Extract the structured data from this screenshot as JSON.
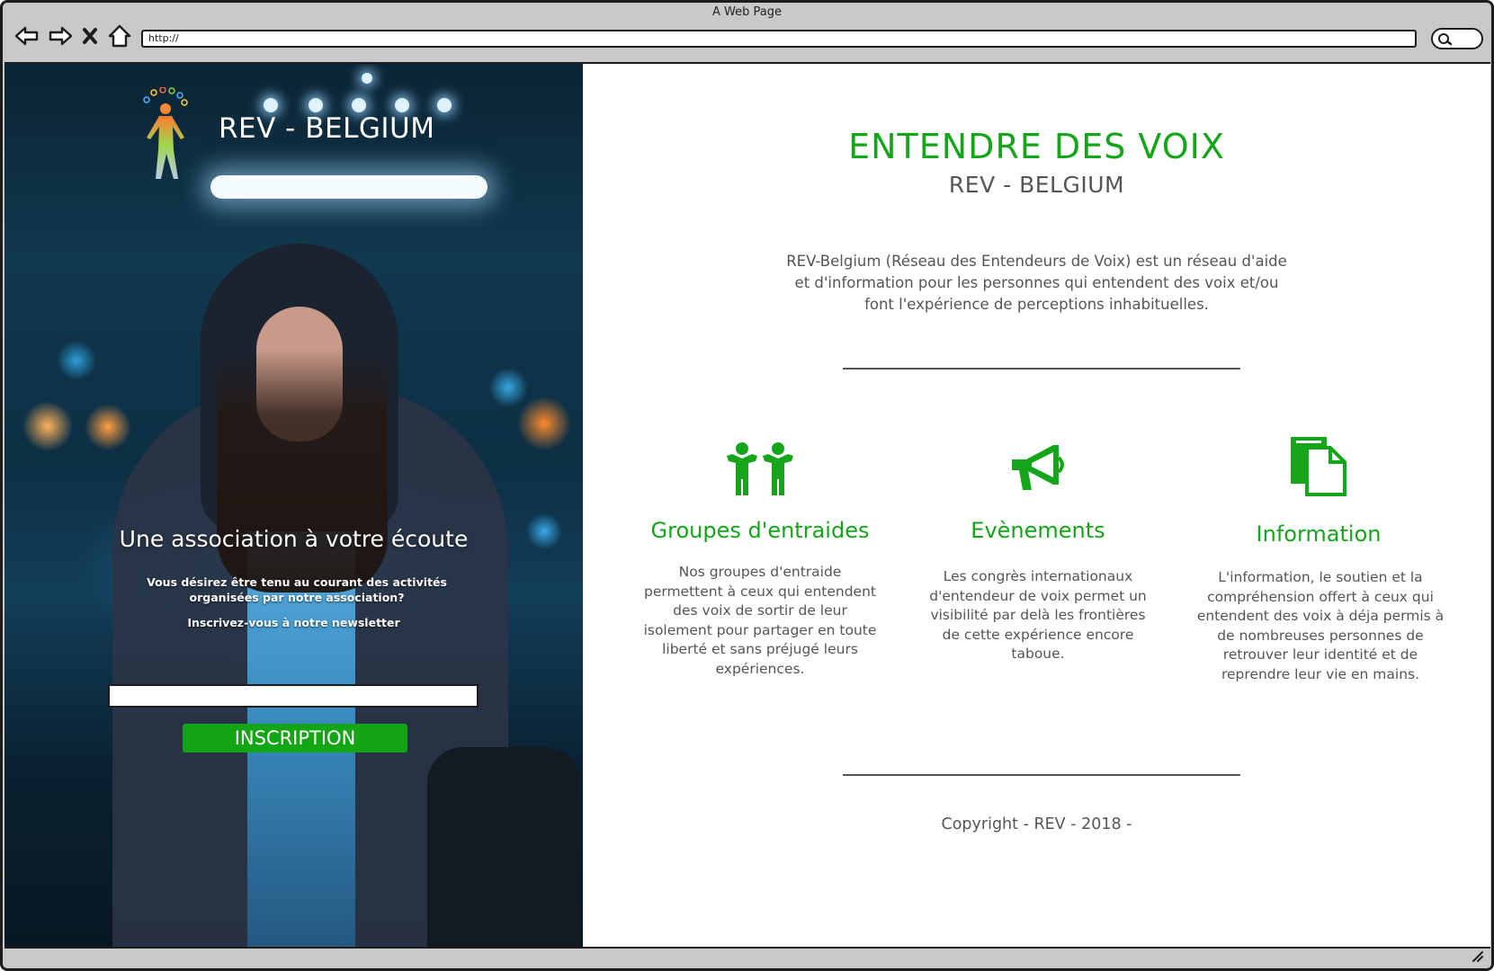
{
  "browser": {
    "title": "A Web Page",
    "url": "http://",
    "icons": [
      "back-icon",
      "forward-icon",
      "close-icon",
      "home-icon",
      "search-icon"
    ]
  },
  "hero": {
    "brand": "REV - BELGIUM",
    "tagline": "Une association à votre écoute",
    "text": "Vous désirez être tenu au courant des activités organisées par notre association?",
    "newsletter": "Inscrivez-vous à notre newsletter",
    "email_value": "",
    "button_label": "INSCRIPTION"
  },
  "main": {
    "title": "ENTENDRE DES VOIX",
    "subtitle": "REV - BELGIUM",
    "intro": "REV-Belgium (Réseau des Entendeurs de Voix) est un réseau d'aide et d'information pour les personnes qui entendent des voix et/ou font l'expérience de perceptions inhabituelles."
  },
  "features": [
    {
      "icon": "people-icon",
      "title": "Groupes d'entraides",
      "text": "Nos groupes d'entraide permettent à ceux qui entendent des voix de sortir de leur isolement pour partager en toute liberté et sans préjugé leurs expériences."
    },
    {
      "icon": "megaphone-icon",
      "title": "Evènements",
      "text": "Les congrès internationaux d'entendeur de voix permet un visibilité par delà les frontières de cette expérience encore taboue."
    },
    {
      "icon": "document-icon",
      "title": "Information",
      "text": "L'information, le soutien et la compréhension offert à ceux qui entendent des voix à déja permis à de nombreuses personnes de retrouver leur identité et de reprendre leur vie en mains."
    }
  ],
  "footer": {
    "copyright": "Copyright - REV - 2018 -"
  },
  "colors": {
    "accent": "#14a51a",
    "text": "#555555",
    "button": "#13a513"
  }
}
